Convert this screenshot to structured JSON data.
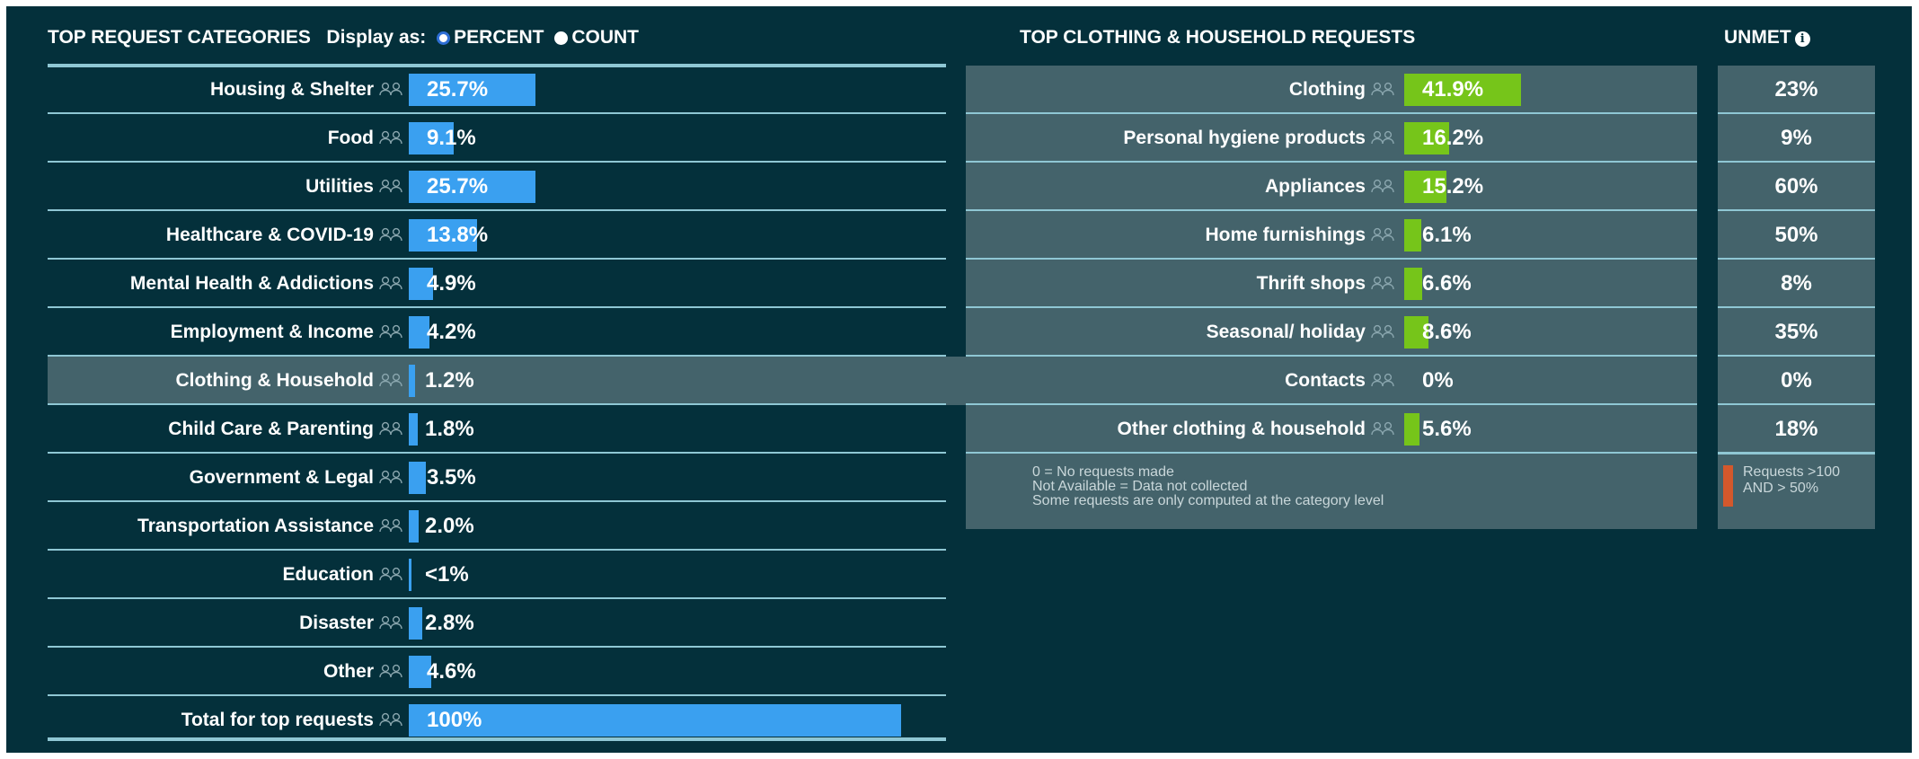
{
  "left_header": {
    "title": "TOP REQUEST CATEGORIES",
    "display_as": "Display as:",
    "option_percent": "PERCENT",
    "option_count": "COUNT",
    "selected": "PERCENT"
  },
  "mid_header": {
    "title": "TOP CLOTHING & HOUSEHOLD REQUESTS"
  },
  "unmet_header": {
    "title": "UNMET",
    "icon": "info-icon"
  },
  "colors": {
    "background": "#04303b",
    "category_bar": "#3aa0f0",
    "subcategory_bar": "#76c51a",
    "highlight_row": "#44636b",
    "divider": "#8fc7d4",
    "unmet_flag": "#d4582c"
  },
  "chart_data": [
    {
      "type": "bar",
      "orientation": "horizontal",
      "title": "TOP REQUEST CATEGORIES",
      "unit": "percent",
      "categories": [
        "Housing & Shelter",
        "Food",
        "Utilities",
        "Healthcare & COVID-19",
        "Mental Health & Addictions",
        "Employment & Income",
        "Clothing & Household",
        "Child Care & Parenting",
        "Government & Legal",
        "Transportation Assistance",
        "Education",
        "Disaster",
        "Other",
        "Total for top requests"
      ],
      "values": [
        25.7,
        9.1,
        25.7,
        13.8,
        4.9,
        4.2,
        1.2,
        1.8,
        3.5,
        2.0,
        0.5,
        2.8,
        4.6,
        100
      ],
      "labels": [
        "25.7%",
        "9.1%",
        "25.7%",
        "13.8%",
        "4.9%",
        "4.2%",
        "1.2%",
        "1.8%",
        "3.5%",
        "2.0%",
        "<1%",
        "2.8%",
        "4.6%",
        "100%"
      ],
      "highlighted": "Clothing & Household",
      "xlim": [
        0,
        100
      ]
    },
    {
      "type": "bar",
      "orientation": "horizontal",
      "title": "TOP CLOTHING & HOUSEHOLD REQUESTS",
      "unit": "percent",
      "categories": [
        "Clothing",
        "Personal hygiene products",
        "Appliances",
        "Home furnishings",
        "Thrift shops",
        "Seasonal/ holiday",
        "Contacts",
        "Other clothing & household"
      ],
      "values": [
        41.9,
        16.2,
        15.2,
        6.1,
        6.6,
        8.6,
        0,
        5.6
      ],
      "labels": [
        "41.9%",
        "16.2%",
        "15.2%",
        "6.1%",
        "6.6%",
        "8.6%",
        "0%",
        "5.6%"
      ],
      "unmet": [
        "23%",
        "9%",
        "60%",
        "50%",
        "8%",
        "35%",
        "0%",
        "18%"
      ],
      "xlim": [
        0,
        100
      ]
    }
  ],
  "notes": {
    "lines": [
      "0 = No requests made",
      "Not Available = Data not collected",
      "Some requests are only computed at the category level"
    ]
  },
  "legend": {
    "flag_label": "Requests >100 AND > 50%"
  }
}
